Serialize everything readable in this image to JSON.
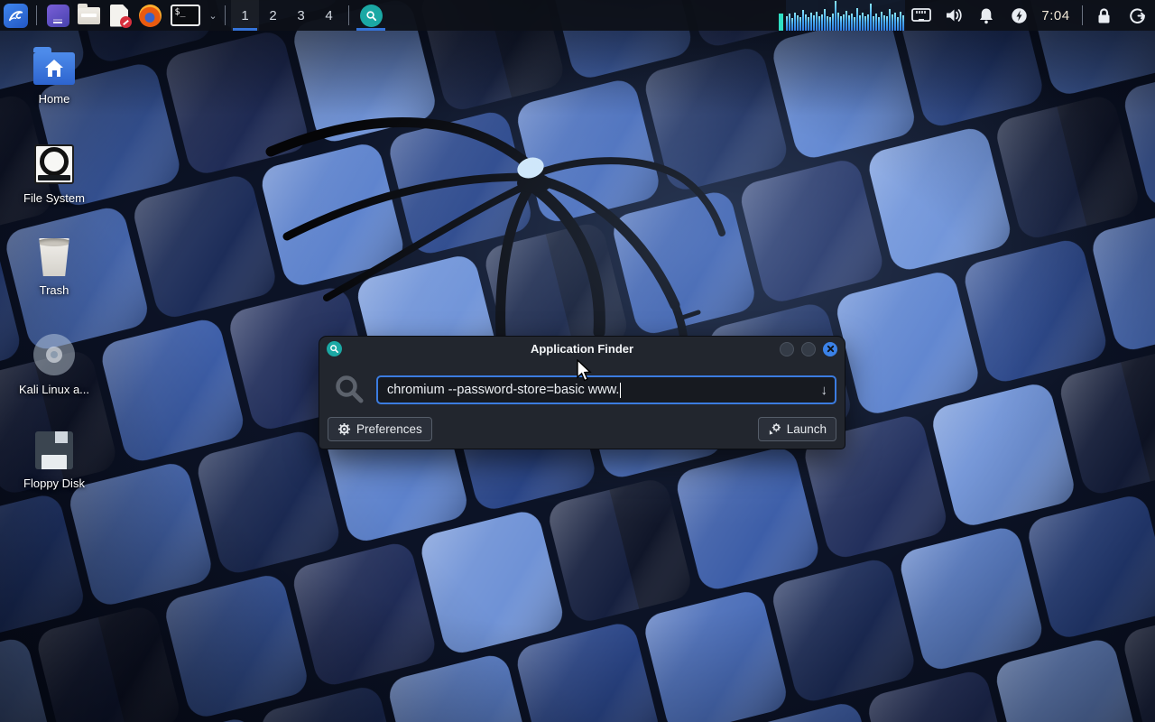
{
  "colors": {
    "accent_blue": "#3b7ce0",
    "panel_underline": "#3473d8",
    "search_teal": "#1ba8a4",
    "close_button_blue": "#3b82e8",
    "cpu_bar_top": "#8ae6ff",
    "cpu_bar_bottom": "#2f7ce0"
  },
  "panel": {
    "workspaces": [
      "1",
      "2",
      "3",
      "4"
    ],
    "active_workspace": "1",
    "terminal_launcher_label": "$_",
    "clock": "7:04"
  },
  "desktop": {
    "icons": [
      {
        "label": "Home"
      },
      {
        "label": "File System"
      },
      {
        "label": "Trash"
      },
      {
        "label": "Kali Linux a..."
      },
      {
        "label": "Floppy Disk"
      }
    ]
  },
  "finder": {
    "title": "Application Finder",
    "query": "chromium --password-store=basic www.",
    "preferences_label": "Preferences",
    "launch_label": "Launch"
  },
  "cpu_graph": {
    "bars": [
      48,
      55,
      42,
      60,
      50,
      45,
      68,
      52,
      44,
      58,
      49,
      62,
      46,
      54,
      70,
      48,
      43,
      57,
      98,
      60,
      47,
      52,
      64,
      49,
      55,
      45,
      75,
      50,
      58,
      46,
      52,
      88,
      48,
      56,
      44,
      61,
      51,
      47,
      72,
      53,
      58,
      45,
      63,
      50
    ]
  }
}
